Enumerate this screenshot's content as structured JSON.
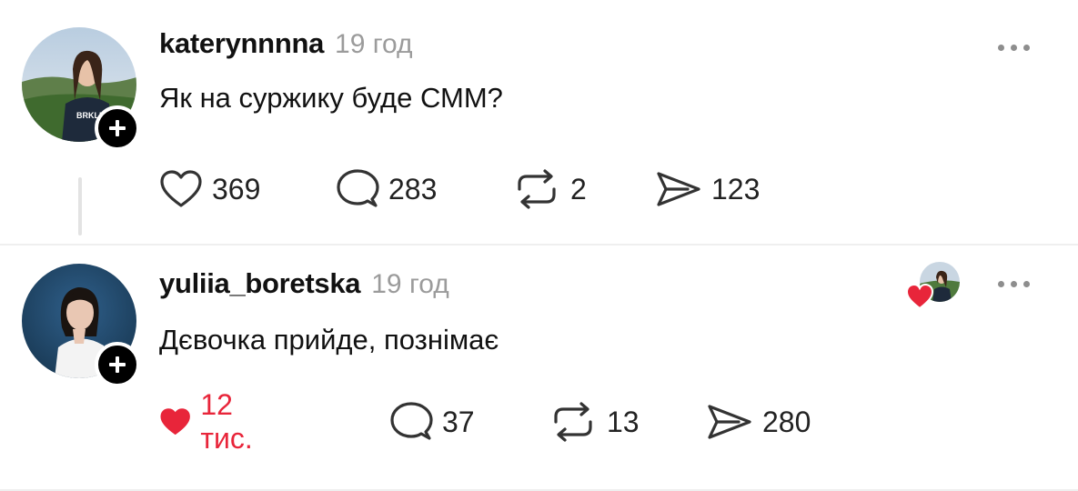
{
  "posts": [
    {
      "username": "katerynnnna",
      "time": "19 год",
      "text": "Як на суржику буде СММ?",
      "likes": "369",
      "replies": "283",
      "reposts": "2",
      "shares": "123",
      "liked": false
    },
    {
      "username": "yuliia_boretska",
      "time": "19 год",
      "text": "Дєвочка прийде, познімає",
      "likes": "12 тис.",
      "replies": "37",
      "reposts": "13",
      "shares": "280",
      "liked": true
    }
  ],
  "icons": {
    "like": "heart-icon",
    "reply": "speech-bubble-icon",
    "repost": "repost-icon",
    "share": "send-icon",
    "more": "more-dots-icon",
    "follow": "plus-icon"
  },
  "colors": {
    "like_red": "#e8253a",
    "muted": "#9b9b9b",
    "thread_line": "#e3e3e3"
  }
}
